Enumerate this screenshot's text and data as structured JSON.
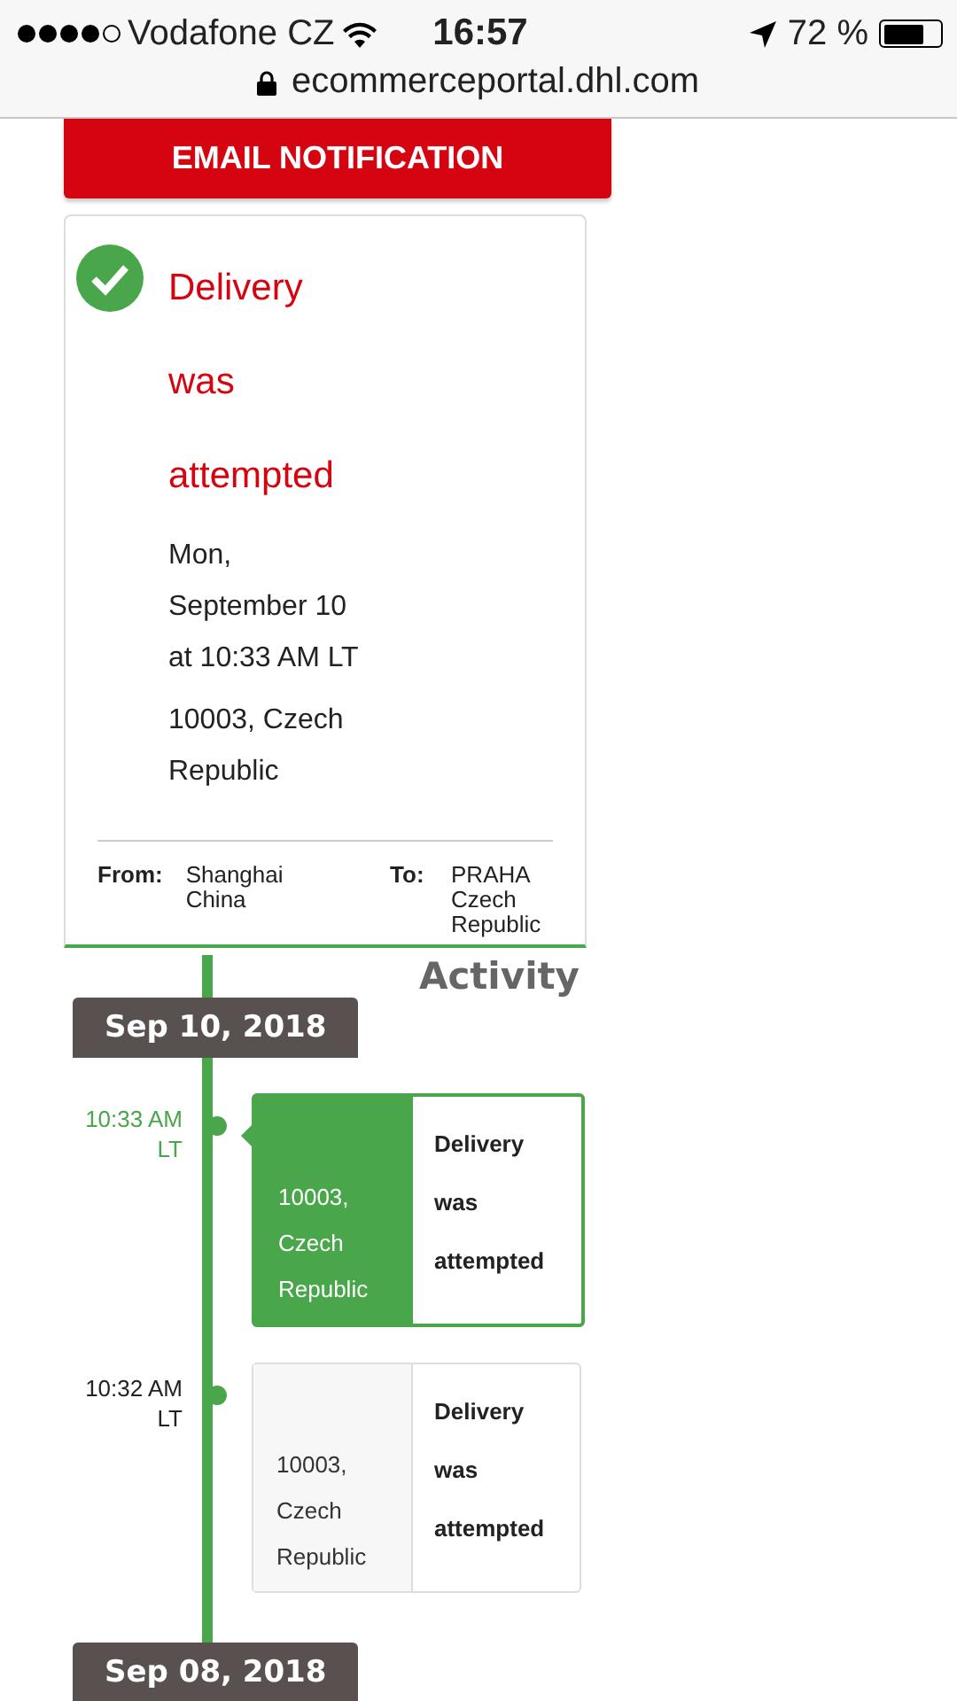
{
  "status_bar": {
    "carrier": "Vodafone CZ",
    "time": "16:57",
    "battery": "72 %"
  },
  "address_bar": {
    "url": "ecommerceportal.dhl.com"
  },
  "email_button": {
    "label": "EMAIL NOTIFICATION"
  },
  "summary": {
    "status": "Delivery was attempted",
    "date": "Mon, September 10 at 10:33 AM LT",
    "location": "10003, Czech Republic",
    "from_label": "From:",
    "from_value": "Shanghai China",
    "to_label": "To:",
    "to_value": "PRAHA Czech Republic"
  },
  "activity": {
    "title": "Activity",
    "groups": [
      {
        "date": "Sep 10, 2018",
        "events": [
          {
            "time": "10:33 AM LT",
            "location": "10003, Czech Republic",
            "status": "Delivery was attempted",
            "selected": true
          },
          {
            "time": "10:32 AM LT",
            "location": "10003, Czech Republic",
            "status": "Delivery was attempted",
            "selected": false
          }
        ]
      },
      {
        "date": "Sep 08, 2018"
      }
    ]
  }
}
